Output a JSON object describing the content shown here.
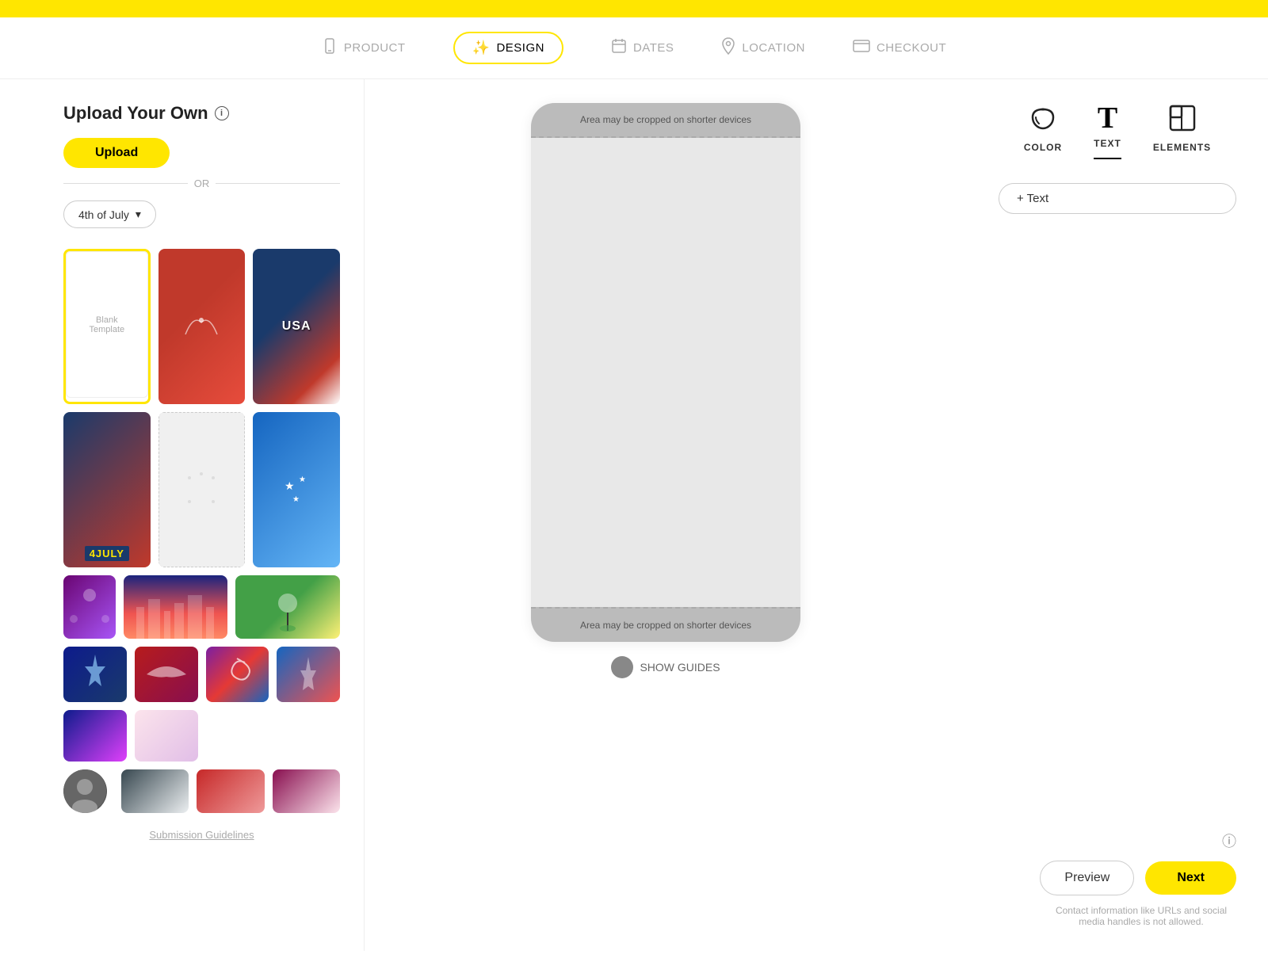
{
  "topBar": {
    "color": "#FFE600"
  },
  "nav": {
    "items": [
      {
        "id": "product",
        "label": "PRODUCT",
        "icon": "📱",
        "active": false
      },
      {
        "id": "design",
        "label": "DESIGN",
        "icon": "✨",
        "active": true
      },
      {
        "id": "dates",
        "label": "DATES",
        "icon": "📅",
        "active": false
      },
      {
        "id": "location",
        "label": "LOCATION",
        "icon": "📍",
        "active": false
      },
      {
        "id": "checkout",
        "label": "CHECKOUT",
        "icon": "💻",
        "active": false
      }
    ]
  },
  "leftPanel": {
    "title": "Upload Your Own",
    "uploadButton": "Upload",
    "orText": "OR",
    "categoryLabel": "4th of July",
    "blankTemplateLabel": "Blank\nTemplate",
    "submissionLink": "Submission Guidelines"
  },
  "centerPanel": {
    "cropText": "Area may be cropped on shorter devices",
    "showGuidesLabel": "SHOW GUIDES"
  },
  "rightPanel": {
    "tabs": [
      {
        "id": "color",
        "label": "COLOR",
        "icon": "✏️",
        "active": false
      },
      {
        "id": "text",
        "label": "TEXT",
        "icon": "T",
        "active": true
      },
      {
        "id": "elements",
        "label": "ELEMENTS",
        "icon": "⬡",
        "active": false
      }
    ],
    "addTextLabel": "+ Text",
    "previewLabel": "Preview",
    "nextLabel": "Next",
    "disclaimer": "Contact information like URLs and social media handles is not allowed."
  }
}
